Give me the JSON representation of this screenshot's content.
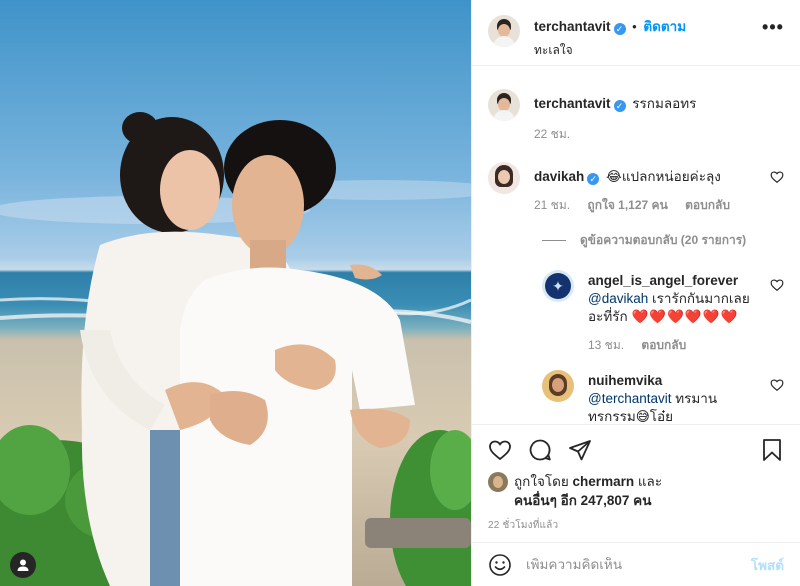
{
  "header": {
    "username": "terchantavit",
    "separator": "•",
    "follow_label": "ติดตาม",
    "location": "ทะเลใจ",
    "more_label": "•••"
  },
  "caption": {
    "username": "terchantavit",
    "text": "รรกมลอทร",
    "time": "22 ชม."
  },
  "comments": [
    {
      "username": "davikah",
      "text": "😂แปลกหน่อยค่ะลุง",
      "time": "21 ชม.",
      "likes": "ถูกใจ 1,127 คน",
      "reply_label": "ตอบกลับ",
      "view_replies": "ดูข้อความตอบกลับ (20 รายการ)"
    }
  ],
  "replies": [
    {
      "username": "angel_is_angel_forever",
      "mention": "@davikah",
      "text": " เรารักกันมากเลยอะที่รัก ",
      "hearts": "❤️❤️❤️❤️❤️❤️",
      "time": "13 ชม.",
      "reply_label": "ตอบกลับ"
    },
    {
      "username": "nuihemvika",
      "mention": "@terchantavit",
      "text": " ทรมานทรกรรม😅โอ๋ย"
    }
  ],
  "likes": {
    "prefix": "ถูกใจโดย",
    "by_user": "chermarn",
    "and": "และ",
    "others": "คนอื่นๆ อีก 247,807 คน"
  },
  "timestamp": "22 ชั่วโมงที่แล้ว",
  "add_comment": {
    "placeholder": "เพิ่มความคิดเห็น",
    "post_label": "โพสต์"
  },
  "colors": {
    "accent": "#0095f6",
    "verified": "#3897f0",
    "heart_red": "#ed4956",
    "muted": "#8e8e8e"
  }
}
